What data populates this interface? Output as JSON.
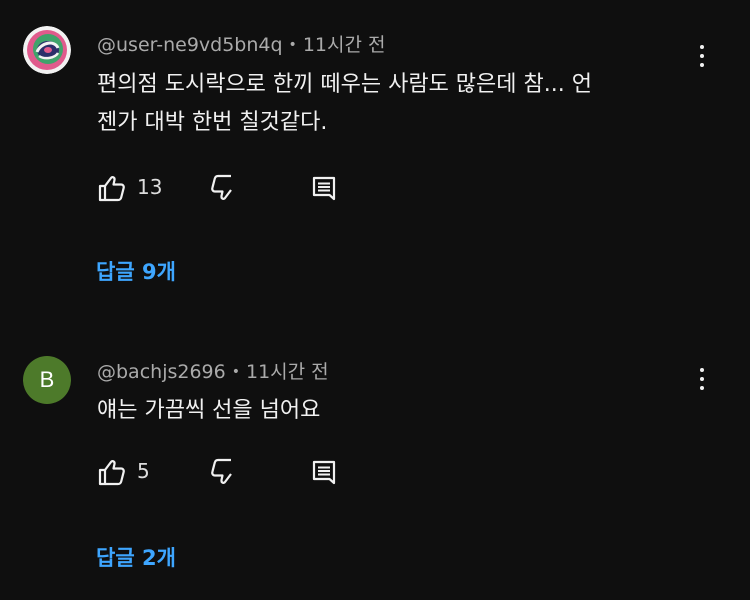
{
  "comments": [
    {
      "handle": "@user-ne9vd5bn4q",
      "time": "11시간 전",
      "text_lines": [
        "편의점 도시락으로 한끼 떼우는 사람도 많은데 참...  언",
        "젠가 대박 한번 칠것같다."
      ],
      "likes": "13",
      "replies_label": "답글 9개",
      "avatar": {
        "type": "image",
        "icon": "swirl-avatar-icon",
        "colors": [
          "#e05a8c",
          "#3fa36b",
          "#2b2f6b"
        ]
      }
    },
    {
      "handle": "@bachjs2696",
      "time": "11시간 전",
      "text_lines": [
        "얘는 가끔씩 선을 넘어요"
      ],
      "likes": "5",
      "replies_label": "답글 2개",
      "avatar": {
        "type": "letter",
        "letter": "B",
        "color": "#4d7a2a"
      }
    }
  ],
  "separator": "•",
  "icons": {
    "like": "thumbs-up-icon",
    "dislike": "thumbs-down-icon",
    "reply": "reply-icon",
    "more": "more-vertical-icon"
  },
  "colors": {
    "background": "#0f0f0f",
    "link": "#3ea6ff",
    "meta": "#aaaaaa"
  }
}
